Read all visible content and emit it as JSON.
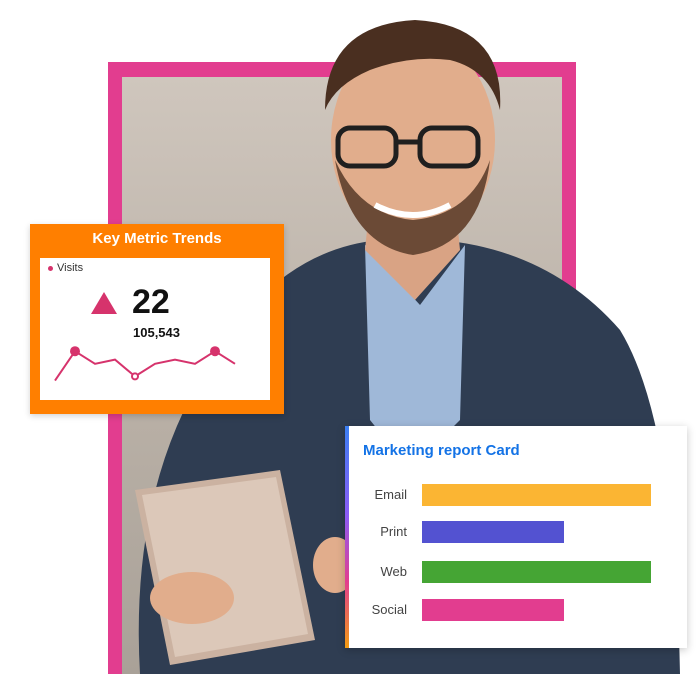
{
  "key_metric_card": {
    "title": "Key Metric Trends",
    "legend_label": "Visits",
    "value": "22",
    "subvalue": "105,543",
    "colors": {
      "header": "#ff7f00",
      "accent": "#d6336c"
    },
    "sparkline": [
      2,
      9,
      6,
      7,
      3,
      6,
      7,
      6,
      9,
      6
    ]
  },
  "marketing_card": {
    "title": "Marketing report Card",
    "rows": [
      {
        "label": "Email",
        "value": 100,
        "color": "#fbb533"
      },
      {
        "label": "Print",
        "value": 62,
        "color": "#5352d1"
      },
      {
        "label": "Web",
        "value": 100,
        "color": "#45a534"
      },
      {
        "label": "Social",
        "value": 62,
        "color": "#e23d8f"
      }
    ]
  },
  "photo": {
    "subject": "smiling man with glasses using a tablet"
  }
}
